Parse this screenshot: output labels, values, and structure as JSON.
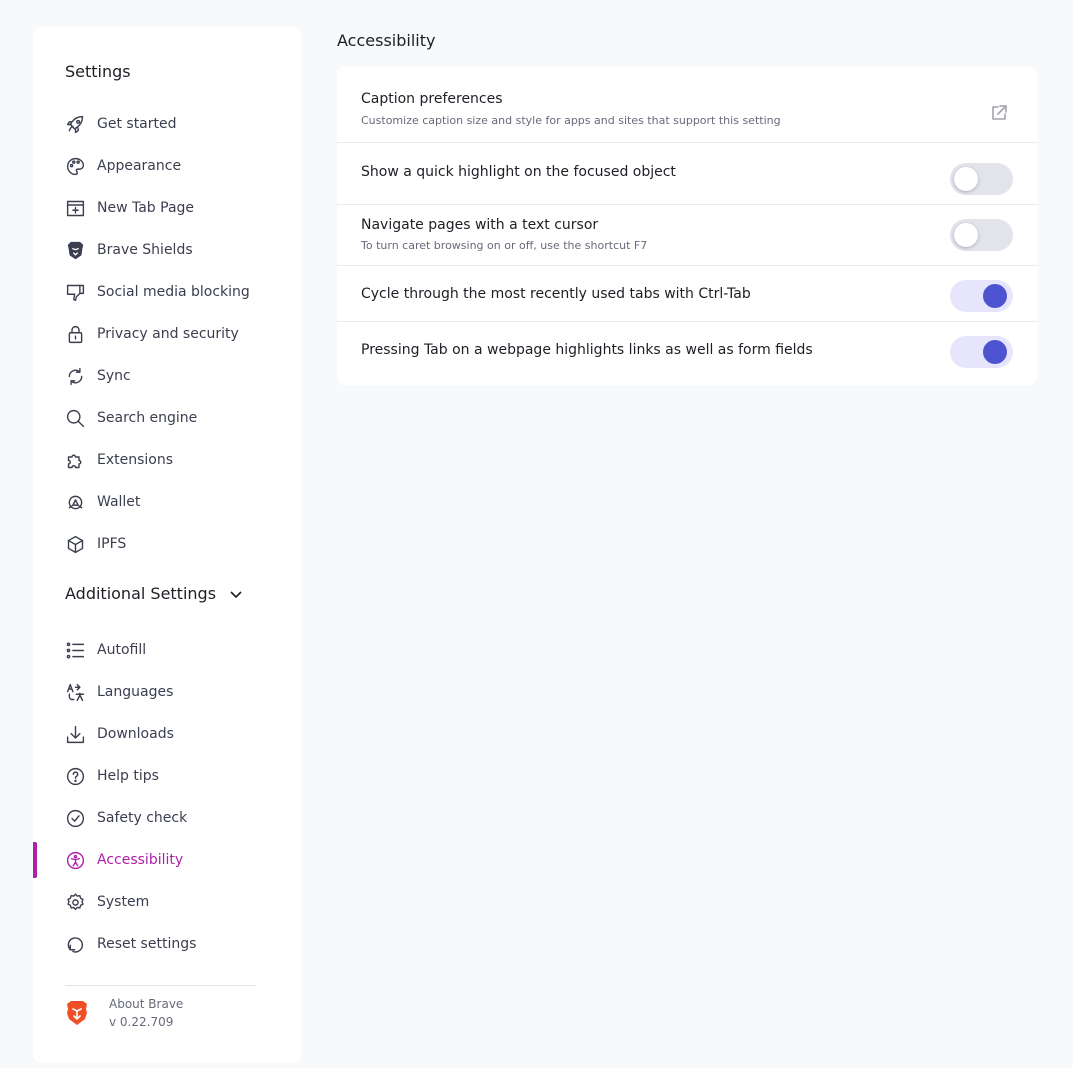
{
  "sidebar": {
    "title": "Settings",
    "items": [
      {
        "label": "Get started",
        "icon": "rocket-icon"
      },
      {
        "label": "Appearance",
        "icon": "palette-icon"
      },
      {
        "label": "New Tab Page",
        "icon": "new-tab-icon"
      },
      {
        "label": "Brave Shields",
        "icon": "shield-lion-icon"
      },
      {
        "label": "Social media blocking",
        "icon": "thumbs-down-icon"
      },
      {
        "label": "Privacy and security",
        "icon": "lock-icon"
      },
      {
        "label": "Sync",
        "icon": "sync-icon"
      },
      {
        "label": "Search engine",
        "icon": "search-icon"
      },
      {
        "label": "Extensions",
        "icon": "puzzle-icon"
      },
      {
        "label": "Wallet",
        "icon": "wallet-icon"
      },
      {
        "label": "IPFS",
        "icon": "cube-icon"
      }
    ],
    "additional_label": "Additional Settings",
    "additional_items": [
      {
        "label": "Autofill",
        "icon": "list-icon"
      },
      {
        "label": "Languages",
        "icon": "translate-icon"
      },
      {
        "label": "Downloads",
        "icon": "download-icon"
      },
      {
        "label": "Help tips",
        "icon": "help-icon"
      },
      {
        "label": "Safety check",
        "icon": "check-circle-icon"
      },
      {
        "label": "Accessibility",
        "icon": "accessibility-icon",
        "active": true
      },
      {
        "label": "System",
        "icon": "gear-icon"
      },
      {
        "label": "Reset settings",
        "icon": "reset-icon"
      }
    ],
    "about": {
      "name": "About Brave",
      "version": "v 0.22.709"
    }
  },
  "main": {
    "title": "Accessibility",
    "rows": [
      {
        "label": "Caption preferences",
        "sub": "Customize caption size and style for apps and sites that support this setting",
        "control": "external-link"
      },
      {
        "label": "Show a quick highlight on the focused object",
        "control": "toggle",
        "on": false
      },
      {
        "label": "Navigate pages with a text cursor",
        "sub": "To turn caret browsing on or off, use the shortcut F7",
        "control": "toggle",
        "on": false
      },
      {
        "label": "Cycle through the most recently used tabs with Ctrl-Tab",
        "control": "toggle",
        "on": true
      },
      {
        "label": "Pressing Tab on a webpage highlights links as well as form fields",
        "control": "toggle",
        "on": true
      }
    ]
  },
  "colors": {
    "accent": "#b01fa8",
    "toggle_on": "#4c54d2",
    "toggle_on_track": "#e6e5fc",
    "toggle_off_track": "#e3e3ec"
  }
}
